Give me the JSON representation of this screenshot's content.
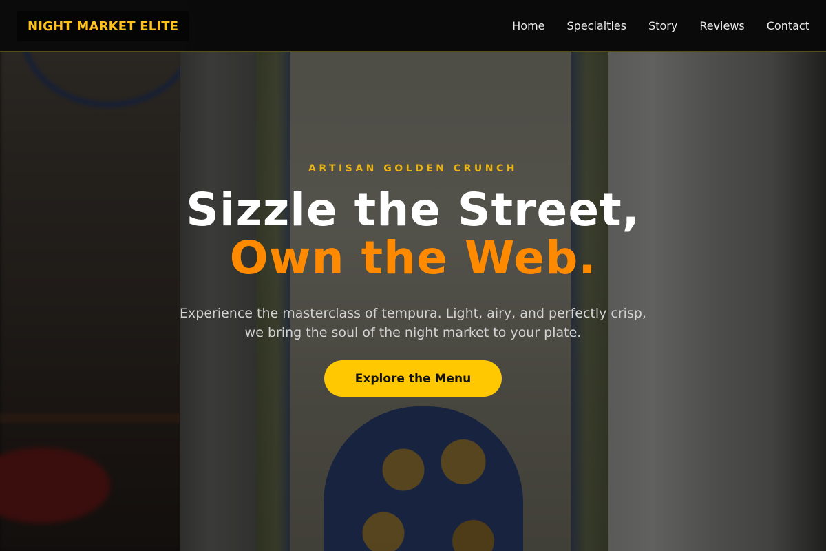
{
  "navbar": {
    "logo": "NIGHT MARKET ELITE",
    "links": [
      "Home",
      "Specialties",
      "Story",
      "Reviews",
      "Contact"
    ]
  },
  "hero": {
    "eyebrow": "ARTISAN GOLDEN CRUNCH",
    "headline_line1": "Sizzle the Street,",
    "headline_line2": "Own the Web.",
    "subtitle": "Experience the masterclass of tempura. Light, airy, and perfectly crisp, we bring the soul of the night market to your plate.",
    "cta_label": "Explore the Menu"
  },
  "colors": {
    "brand_gold": "#ffc21a",
    "accent_orange": "#ff8a00",
    "button_yellow": "#ffc800",
    "navbar_bg": "#0a0a0a"
  }
}
